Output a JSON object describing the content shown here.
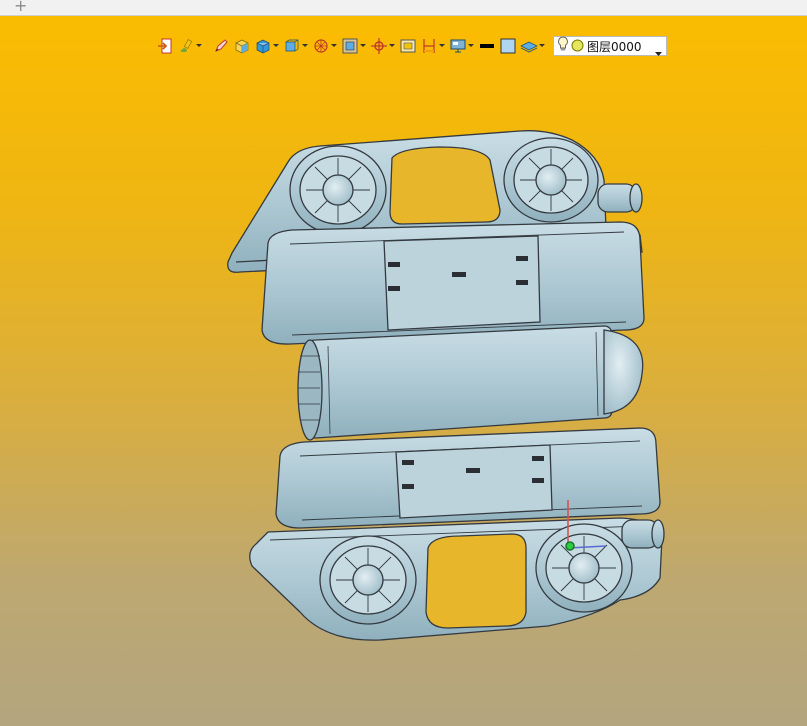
{
  "tabbar": {
    "add_label": "+"
  },
  "toolbar": {
    "buttons": [
      {
        "icon": "exit-icon",
        "caret": false
      },
      {
        "icon": "paint-brush-icon",
        "caret": true
      },
      {
        "icon": "pen-icon",
        "caret": false
      },
      {
        "icon": "box-yellow-icon",
        "caret": false
      },
      {
        "icon": "cube-shaded-icon",
        "caret": true
      },
      {
        "icon": "cube-wire-icon",
        "caret": true
      },
      {
        "icon": "section-view-icon",
        "caret": true
      },
      {
        "icon": "frame-icon",
        "caret": true
      },
      {
        "icon": "orient-icon",
        "caret": true
      },
      {
        "icon": "fit-view-icon",
        "caret": false
      },
      {
        "icon": "dimension-icon",
        "caret": true
      },
      {
        "icon": "monitor-icon",
        "caret": true
      },
      {
        "icon": "line-color-icon",
        "caret": false
      },
      {
        "icon": "fill-color-icon",
        "caret": false
      },
      {
        "icon": "layers-icon",
        "caret": true
      }
    ],
    "layer": {
      "value": "图层0000",
      "icons": [
        "lightbulb-icon",
        "layer-color-dot-icon"
      ]
    }
  },
  "viewport": {
    "gradient": [
      "#fbbc00",
      "#b4a57f"
    ],
    "model_color": "#aec9d4",
    "outline_color": "#3a3f44"
  }
}
